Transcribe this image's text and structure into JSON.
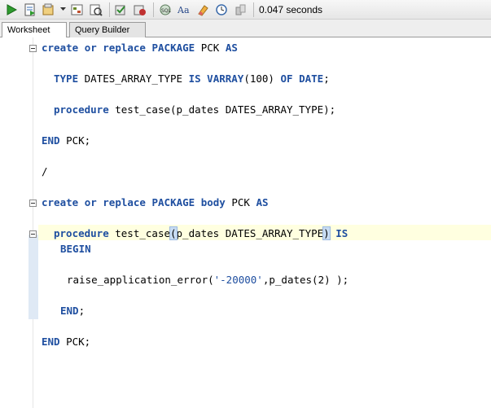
{
  "toolbar": {
    "icons": [
      {
        "name": "run-statement-icon",
        "color": "#2e9b2e"
      },
      {
        "name": "run-script-icon",
        "color": "#3a6fb5"
      },
      {
        "name": "commit-icon",
        "color": "#b07a20"
      },
      {
        "name": "explain-plan-icon",
        "color": "#6a8a2a"
      },
      {
        "name": "autotrace-icon",
        "color": "#6a6a9a"
      },
      {
        "name": "rollback-icon",
        "color": "#3a8a3a"
      },
      {
        "name": "rollback-cancel-icon",
        "color": "#a03030"
      },
      {
        "name": "sql-tuning-icon",
        "color": "#5a7a5a"
      },
      {
        "name": "format-text-icon",
        "color": "#2a4a8a"
      },
      {
        "name": "clear-icon",
        "color": "#c88a20"
      },
      {
        "name": "history-icon",
        "color": "#3a6aaa"
      },
      {
        "name": "unshared-worksheet-icon",
        "color": "#9a9a9a"
      }
    ],
    "timing": "0.047 seconds"
  },
  "tabs": [
    {
      "label": "Worksheet",
      "active": true
    },
    {
      "label": "Query Builder",
      "active": false
    }
  ],
  "code": {
    "l1": {
      "k1": "create",
      "k2": "or",
      "k3": "replace",
      "k4": "PACKAGE",
      "t1": " PCK ",
      "k5": "AS"
    },
    "l2": {
      "k1": "TYPE",
      "t1": " DATES_ARRAY_TYPE ",
      "k2": "IS",
      "k3": "VARRAY",
      "t2": "(100) ",
      "k4": "OF",
      "k5": "DATE",
      "t3": ";"
    },
    "l3": {
      "k1": "procedure",
      "t1": " test_case(p_dates DATES_ARRAY_TYPE);"
    },
    "l4": {
      "k1": "END",
      "t1": " PCK;"
    },
    "l5": {
      "t1": "/"
    },
    "l6": {
      "k1": "create",
      "k2": "or",
      "k3": "replace",
      "k4": "PACKAGE",
      "k5": "body",
      "t1": " PCK ",
      "k6": "AS"
    },
    "l7": {
      "k1": "procedure",
      "t1": " test_case",
      "p1": "(",
      "t2": "p_dates DATES_ARRAY_TYPE",
      "p2": ")",
      "k2": "IS"
    },
    "l8": {
      "k1": "BEGIN"
    },
    "l9": {
      "t1": "raise_application_error(",
      "s1": "'-20000'",
      "t2": ",p_dates(2) );"
    },
    "l10": {
      "k1": "END",
      "t1": ";"
    },
    "l11": {
      "k1": "END",
      "t1": " PCK;"
    }
  }
}
